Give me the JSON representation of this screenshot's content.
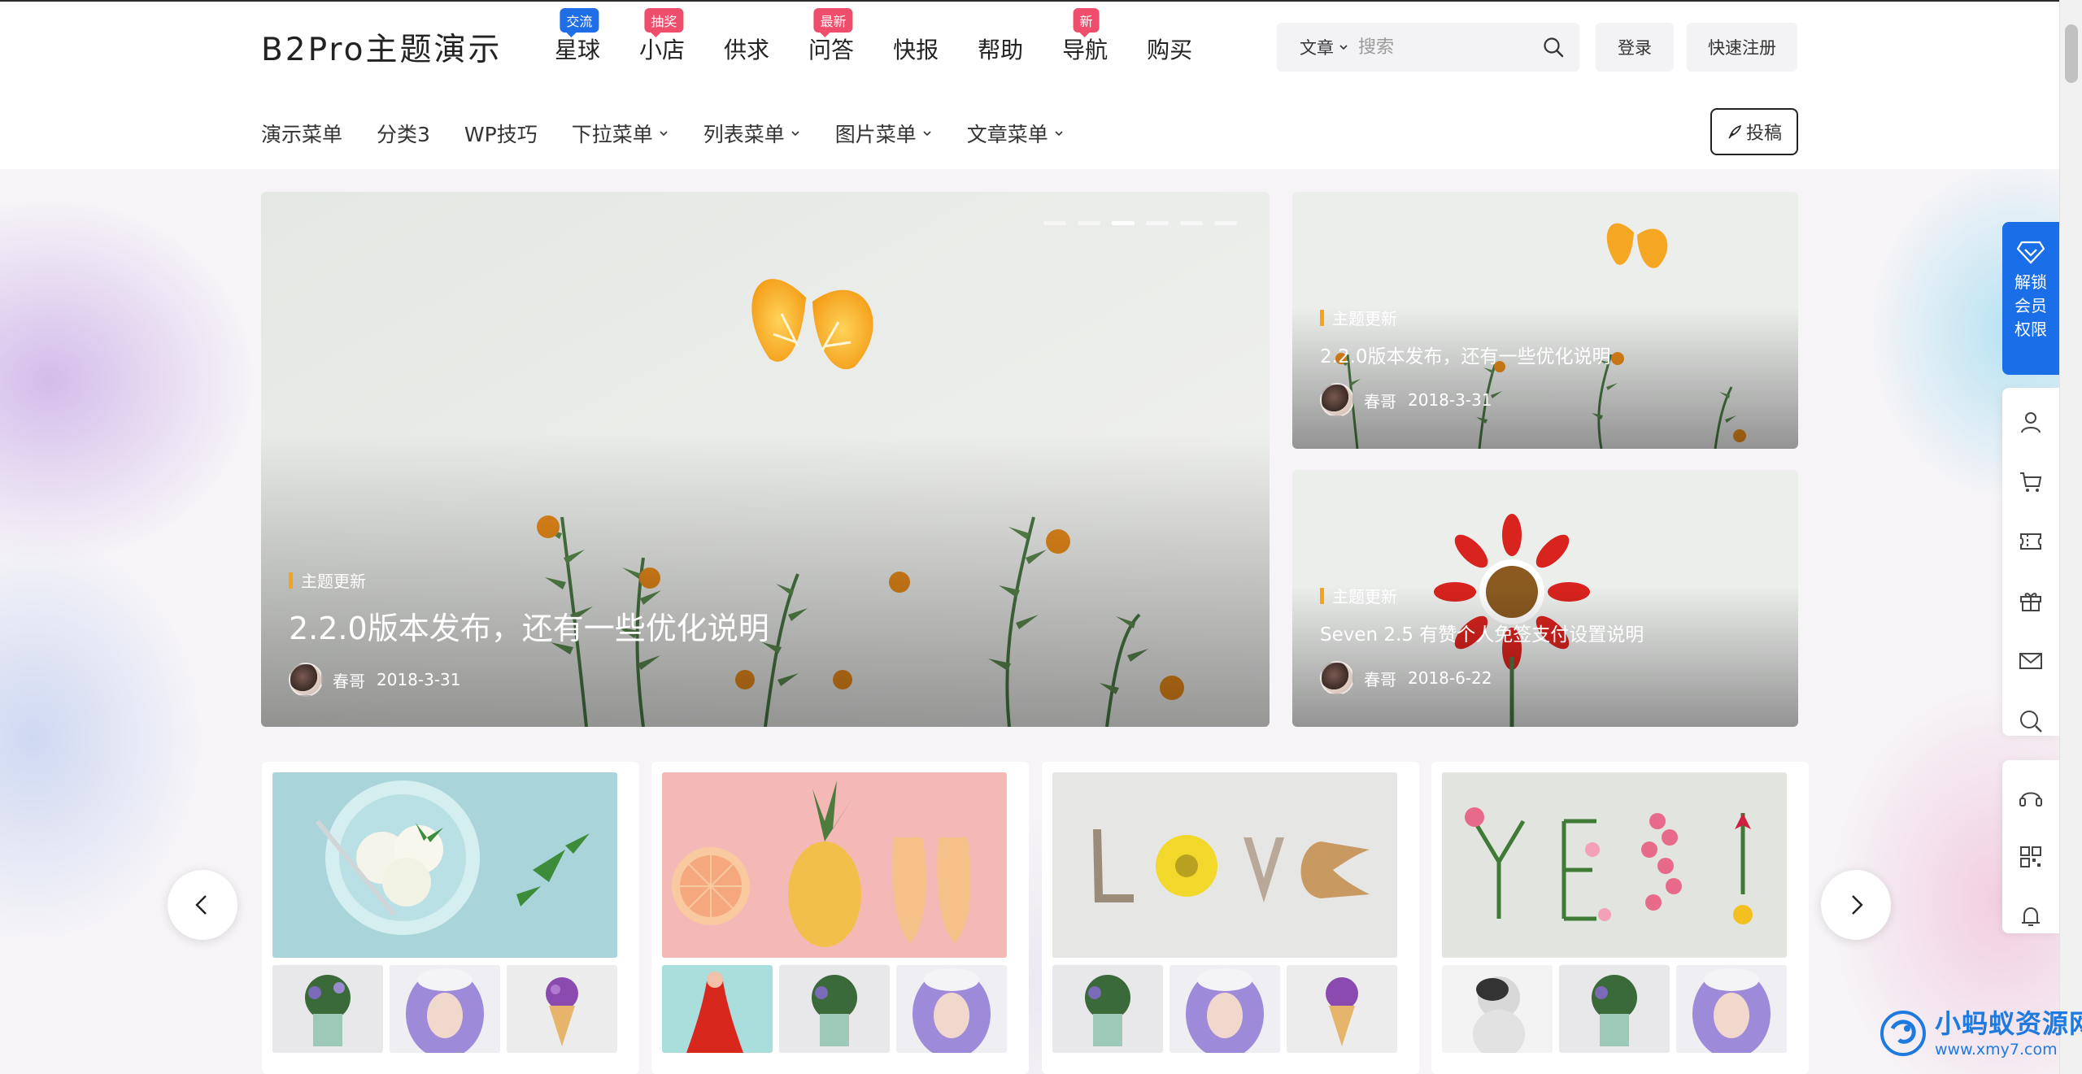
{
  "site": {
    "logo": "B2Pro主题演示"
  },
  "main_nav": [
    {
      "label": "星球",
      "badge": "交流",
      "badge_color": "#1f6ee8"
    },
    {
      "label": "小店",
      "badge": "抽奖",
      "badge_color": "#ee4e6b"
    },
    {
      "label": "供求",
      "badge": "",
      "badge_color": ""
    },
    {
      "label": "问答",
      "badge": "最新",
      "badge_color": "#ee4e6b"
    },
    {
      "label": "快报",
      "badge": "",
      "badge_color": ""
    },
    {
      "label": "帮助",
      "badge": "",
      "badge_color": ""
    },
    {
      "label": "导航",
      "badge": "新",
      "badge_color": "#ee4e6b"
    },
    {
      "label": "购买",
      "badge": "",
      "badge_color": ""
    }
  ],
  "search": {
    "type_label": "文章",
    "placeholder": "搜索",
    "value": "",
    "icon": "search-icon"
  },
  "auth": {
    "login_label": "登录",
    "register_label": "快速注册"
  },
  "sub_nav": [
    {
      "label": "演示菜单",
      "has_dropdown": false
    },
    {
      "label": "分类3",
      "has_dropdown": false
    },
    {
      "label": "WP技巧",
      "has_dropdown": false
    },
    {
      "label": "下拉菜单",
      "has_dropdown": true
    },
    {
      "label": "列表菜单",
      "has_dropdown": true
    },
    {
      "label": "图片菜单",
      "has_dropdown": true
    },
    {
      "label": "文章菜单",
      "has_dropdown": true
    }
  ],
  "submit_label": "投稿",
  "hero": {
    "slides_count": 6,
    "active_slide": 3,
    "main": {
      "category": "主题更新",
      "title": "2.2.0版本发布，还有一些优化说明",
      "author": "春哥",
      "date": "2018-3-31"
    },
    "side": [
      {
        "category": "主题更新",
        "title": "2.2.0版本发布，还有一些优化说明",
        "author": "春哥",
        "date": "2018-3-31"
      },
      {
        "category": "主题更新",
        "title": "Seven 2.5 有赞个人免签支付设置说明",
        "author": "春哥",
        "date": "2018-6-22"
      }
    ]
  },
  "carousel": {
    "cards": [
      {
        "image": "ice-cream-bowl",
        "thumbs": [
          "plant-pot",
          "purple-hair-portrait",
          "ice-cream-cone"
        ]
      },
      {
        "image": "pineapple-shoes",
        "thumbs": [
          "red-dress-splash",
          "plant-pot",
          "purple-hair-portrait"
        ]
      },
      {
        "image": "love-shells",
        "thumbs": [
          "plant-pot",
          "purple-hair-portrait",
          "ice-cream-cone"
        ]
      },
      {
        "image": "yes-flowers",
        "thumbs": [
          "white-figure",
          "plant-pot",
          "purple-hair-portrait"
        ]
      }
    ]
  },
  "sidebar": {
    "vip_lines": [
      "解锁",
      "会员",
      "权限"
    ],
    "tools": [
      "user-icon",
      "cart-icon",
      "ticket-icon",
      "gift-icon",
      "mail-icon",
      "search-icon",
      "headset-icon",
      "qrcode-icon",
      "bell-icon"
    ]
  },
  "watermark": {
    "title": "小蚂蚁资源网",
    "url": "www.xmy7.com"
  },
  "colors": {
    "accent_blue": "#1a6fe8",
    "badge_pink": "#ee4e6b",
    "tag_orange": "#f7a21b"
  }
}
